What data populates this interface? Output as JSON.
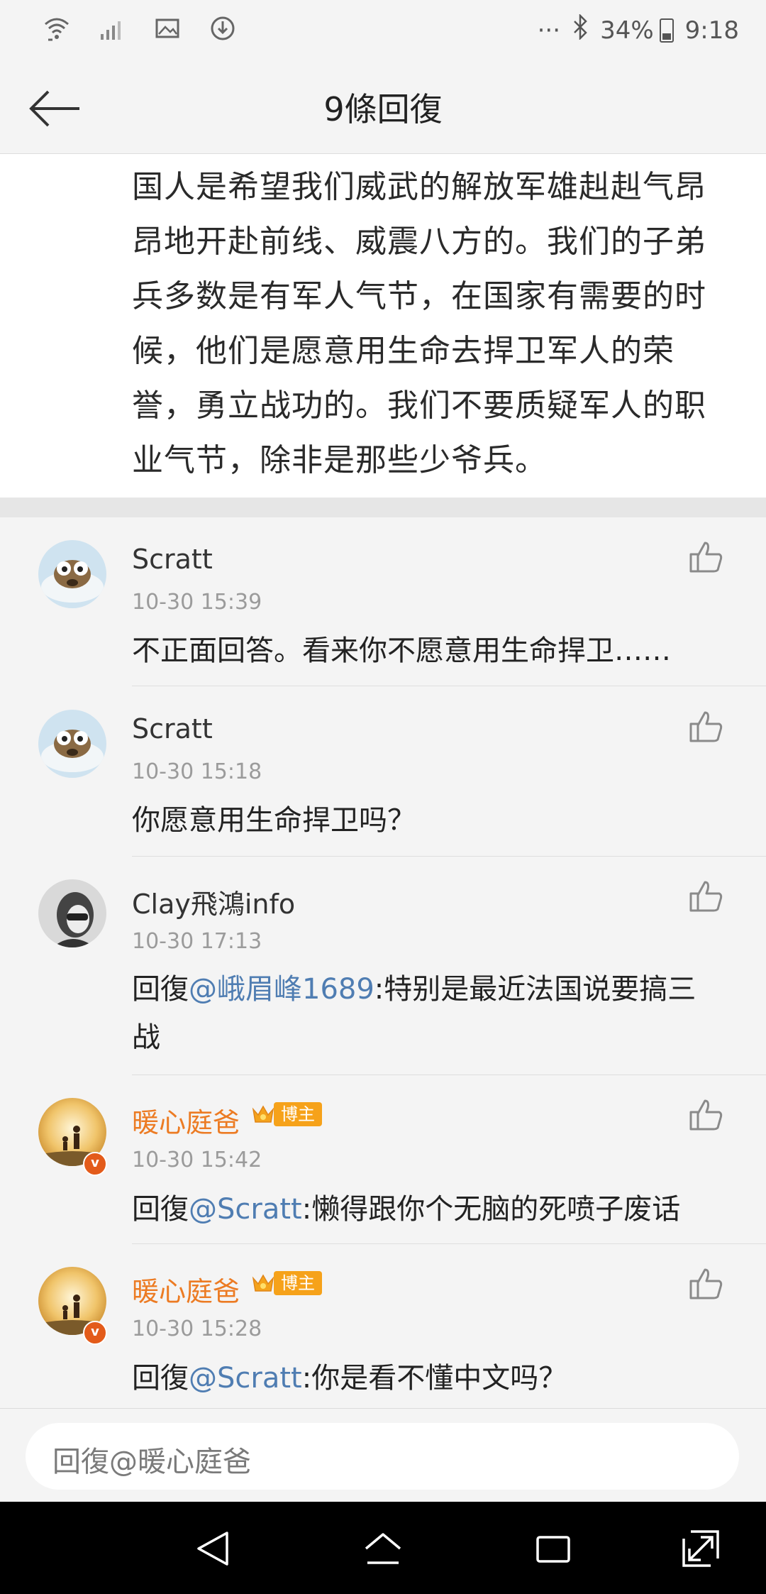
{
  "status_bar": {
    "icons_left": [
      "wifi-icon",
      "signal-icon",
      "image-icon",
      "download-icon"
    ],
    "overflow": "···",
    "battery": "34%",
    "time": "9:18"
  },
  "header": {
    "title": "9條回復"
  },
  "post": {
    "text": "国人是希望我们威武的解放军雄赳赳气昂昂地开赴前线、威震八方的。我们的子弟兵多数是有军人气节，在国家有需要的时候，他们是愿意用生命去捍卫军人的荣誉，勇立战功的。我们不要质疑军人的职业气节，除非是那些少爷兵。"
  },
  "comments": [
    {
      "user": "Scratt",
      "time": "10-30 15:39",
      "prefix": "",
      "mention": "",
      "text": "不正面回答。看来你不愿意用生命捍卫……"
    },
    {
      "user": "Scratt",
      "time": "10-30 15:18",
      "prefix": "",
      "mention": "",
      "text": "你愿意用生命捍卫吗？"
    },
    {
      "user": "Clay飛鴻info",
      "time": "10-30 17:13",
      "prefix": "回復",
      "mention": "@峨眉峰1689",
      "text": ":特别是最近法国说要搞三战"
    },
    {
      "user": "暖心庭爸",
      "badge": "博主",
      "time": "10-30 15:42",
      "prefix": "回復",
      "mention": "@Scratt",
      "text": ":懒得跟你个无脑的死喷子废话"
    },
    {
      "user": "暖心庭爸",
      "badge": "博主",
      "time": "10-30 15:28",
      "prefix": "回復",
      "mention": "@Scratt",
      "text": ":你是看不懂中文吗？"
    }
  ],
  "reply_input": {
    "placeholder": "回復@暖心庭爸"
  },
  "colors": {
    "mention": "#4f7db2",
    "vip_name": "#ec7b23",
    "badge": "#f6a21a"
  }
}
